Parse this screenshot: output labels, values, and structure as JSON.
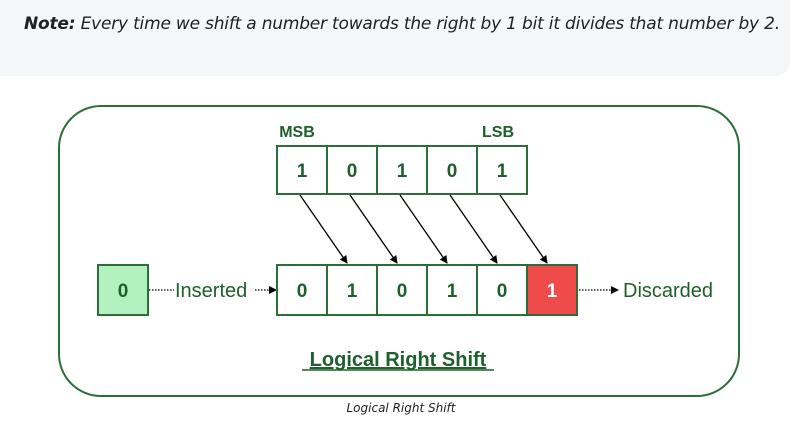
{
  "note": {
    "label": "Note:",
    "text": " Every time we shift a number towards the right by 1 bit it divides that number by 2."
  },
  "diagram": {
    "msb_label": "MSB",
    "lsb_label": "LSB",
    "top_bits": [
      "1",
      "0",
      "1",
      "0",
      "1"
    ],
    "inserted_bit": "0",
    "inserted_label": "Inserted",
    "bottom_bits": [
      "0",
      "1",
      "0",
      "1",
      "0"
    ],
    "discarded_bit": "1",
    "discarded_label": "Discarded",
    "title": "Logical Right Shift",
    "colors": {
      "border": "#2b6e3b",
      "text": "#1e5f2c",
      "inserted_fill": "#b3f2be",
      "discarded_fill": "#f04b4b"
    }
  },
  "caption": "Logical Right Shift"
}
